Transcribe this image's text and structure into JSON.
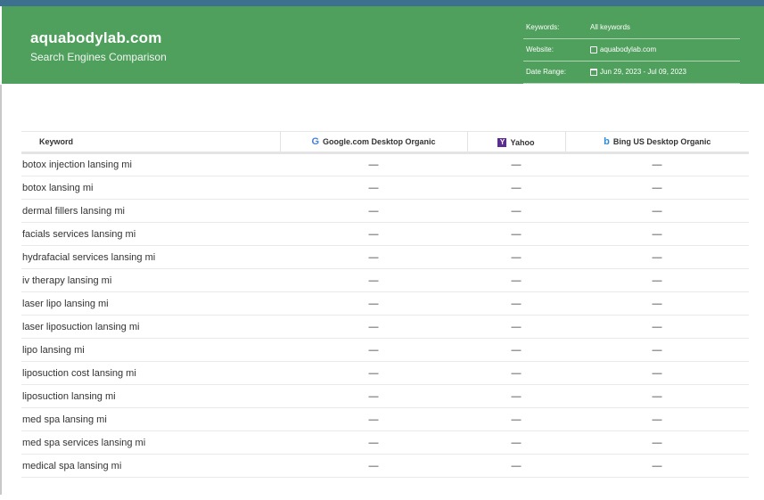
{
  "header": {
    "title": "aquabodylab.com",
    "subtitle": "Search Engines Comparison",
    "meta": [
      {
        "label": "Keywords:",
        "value": "All keywords",
        "icon": ""
      },
      {
        "label": "Website:",
        "value": "aquabodylab.com",
        "icon": "website-icon"
      },
      {
        "label": "Date Range:",
        "value": "Jun 29, 2023 - Jul 09, 2023",
        "icon": "calendar-icon"
      }
    ]
  },
  "table": {
    "columns": [
      {
        "label": "Keyword",
        "icon": ""
      },
      {
        "label": "Google.com Desktop Organic",
        "icon": "google-icon"
      },
      {
        "label": "Yahoo",
        "icon": "yahoo-icon"
      },
      {
        "label": "Bing US Desktop Organic",
        "icon": "bing-icon"
      }
    ],
    "rows": [
      {
        "keyword": "botox injection lansing mi",
        "google": "—",
        "yahoo": "—",
        "bing": "—"
      },
      {
        "keyword": "botox lansing mi",
        "google": "—",
        "yahoo": "—",
        "bing": "—"
      },
      {
        "keyword": "dermal fillers lansing mi",
        "google": "—",
        "yahoo": "—",
        "bing": "—"
      },
      {
        "keyword": "facials services lansing mi",
        "google": "—",
        "yahoo": "—",
        "bing": "—"
      },
      {
        "keyword": "hydrafacial services lansing mi",
        "google": "—",
        "yahoo": "—",
        "bing": "—"
      },
      {
        "keyword": "iv therapy lansing mi",
        "google": "—",
        "yahoo": "—",
        "bing": "—"
      },
      {
        "keyword": "laser lipo lansing mi",
        "google": "—",
        "yahoo": "—",
        "bing": "—"
      },
      {
        "keyword": "laser liposuction lansing mi",
        "google": "—",
        "yahoo": "—",
        "bing": "—"
      },
      {
        "keyword": "lipo lansing mi",
        "google": "—",
        "yahoo": "—",
        "bing": "—"
      },
      {
        "keyword": "liposuction cost lansing mi",
        "google": "—",
        "yahoo": "—",
        "bing": "—"
      },
      {
        "keyword": "liposuction lansing mi",
        "google": "—",
        "yahoo": "—",
        "bing": "—"
      },
      {
        "keyword": "med spa lansing mi",
        "google": "—",
        "yahoo": "—",
        "bing": "—"
      },
      {
        "keyword": "med spa services lansing mi",
        "google": "—",
        "yahoo": "—",
        "bing": "—"
      },
      {
        "keyword": "medical spa lansing mi",
        "google": "—",
        "yahoo": "—",
        "bing": "—"
      }
    ]
  },
  "colors": {
    "header_bg": "#4f9f5d",
    "top_bar": "#3d6f8f",
    "google": "#4a7fd6",
    "yahoo": "#5c2d91",
    "bing": "#2e8bd4"
  }
}
